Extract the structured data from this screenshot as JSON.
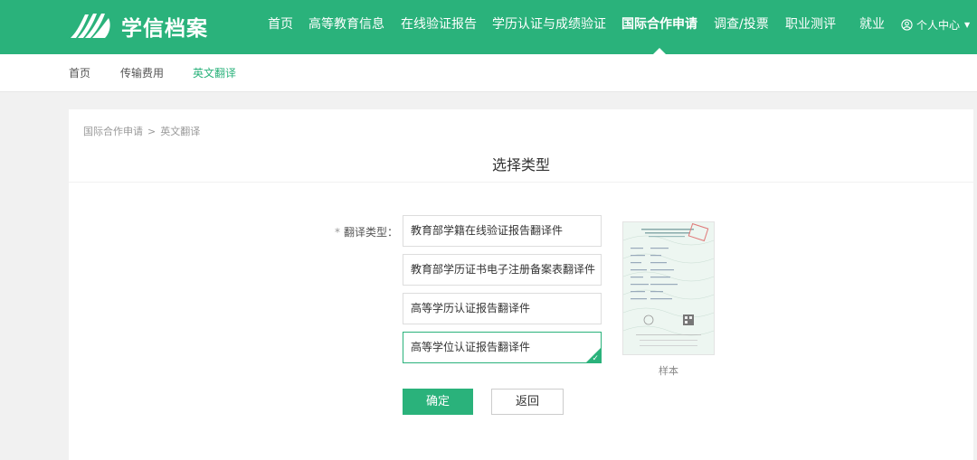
{
  "header": {
    "logo_text": "学信档案",
    "nav": [
      {
        "label": "首页"
      },
      {
        "label": "高等教育信息"
      },
      {
        "label": "在线验证报告"
      },
      {
        "label": "学历认证与成绩验证"
      },
      {
        "label": "国际合作申请",
        "active": true
      },
      {
        "label": "调查/投票"
      },
      {
        "label": "职业测评"
      },
      {
        "label": "就业"
      }
    ],
    "user_center": "个人中心"
  },
  "subnav": [
    {
      "label": "首页"
    },
    {
      "label": "传输费用"
    },
    {
      "label": "英文翻译",
      "active": true
    }
  ],
  "breadcrumb": {
    "parent": "国际合作申请",
    "separator": ">",
    "current": "英文翻译"
  },
  "page_title": "选择类型",
  "form": {
    "required_mark": "*",
    "label": "翻译类型：",
    "options": [
      {
        "label": "教育部学籍在线验证报告翻译件",
        "selected": false
      },
      {
        "label": "教育部学历证书电子注册备案表翻译件",
        "selected": false
      },
      {
        "label": "高等学历认证报告翻译件",
        "selected": false
      },
      {
        "label": "高等学位认证报告翻译件",
        "selected": true
      }
    ],
    "check_mark": "✓",
    "sample_label": "样本",
    "confirm_button": "确定",
    "back_button": "返回"
  },
  "colors": {
    "brand": "#2ab27b"
  },
  "icons": {
    "logo": "book-logo-icon",
    "user": "user-circle-icon",
    "caret": "caret-down-icon"
  }
}
